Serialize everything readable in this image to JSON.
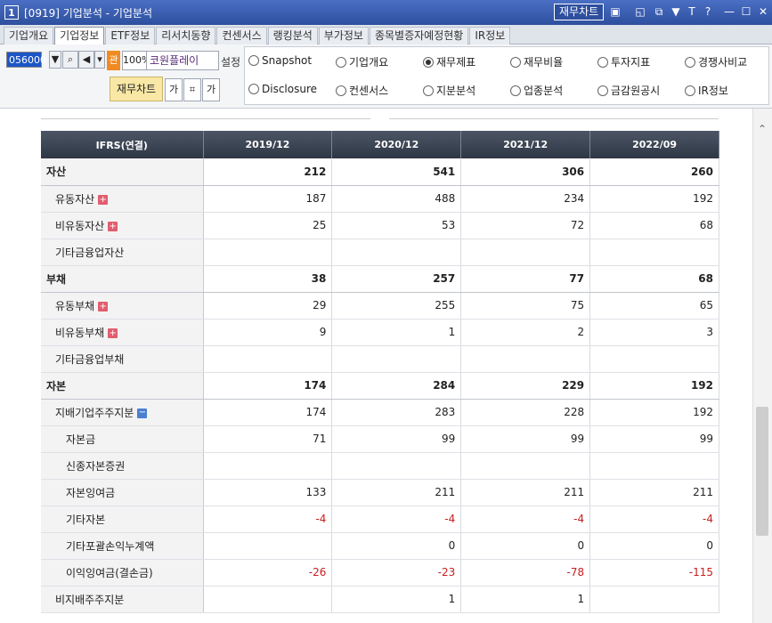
{
  "window": {
    "num": "1",
    "title": "[0919] 기업분석 - 기업분석",
    "chart_button": "재무차트",
    "icons": [
      "chart-icon",
      "restore-icon",
      "copy-icon",
      "pin-icon",
      "font-icon",
      "help-icon",
      "minimize-icon",
      "maximize-icon",
      "close-icon"
    ]
  },
  "tabs": [
    "기업개요",
    "기업정보",
    "ETF정보",
    "리서치동향",
    "컨센서스",
    "랭킹분석",
    "부가정보",
    "종목별증자예정현황",
    "IR정보"
  ],
  "active_tab": 1,
  "toolbar": {
    "code": "056000",
    "pct": "100%",
    "orange": "관",
    "company": "코원플레이",
    "setting": "설정",
    "jaemu_chart": "재무차트",
    "small_a": "가",
    "small_b": "가"
  },
  "radios": [
    {
      "label": "Snapshot",
      "checked": false
    },
    {
      "label": "기업개요",
      "checked": false
    },
    {
      "label": "재무제표",
      "checked": true
    },
    {
      "label": "재무비율",
      "checked": false
    },
    {
      "label": "투자지표",
      "checked": false
    },
    {
      "label": "경쟁사비교",
      "checked": false
    },
    {
      "label": "Disclosure",
      "checked": false
    },
    {
      "label": "컨센서스",
      "checked": false
    },
    {
      "label": "지분분석",
      "checked": false
    },
    {
      "label": "업종분석",
      "checked": false
    },
    {
      "label": "금감원공시",
      "checked": false
    },
    {
      "label": "IR정보",
      "checked": false
    }
  ],
  "table": {
    "headers": [
      "IFRS(연결)",
      "2019/12",
      "2020/12",
      "2021/12",
      "2022/09"
    ],
    "rows": [
      {
        "label": "자산",
        "level": 0,
        "bold": true,
        "values": [
          "212",
          "541",
          "306",
          "260"
        ]
      },
      {
        "label": "유동자산",
        "level": 1,
        "icon": "plus",
        "values": [
          "187",
          "488",
          "234",
          "192"
        ]
      },
      {
        "label": "비유동자산",
        "level": 1,
        "icon": "plus",
        "values": [
          "25",
          "53",
          "72",
          "68"
        ]
      },
      {
        "label": "기타금융업자산",
        "level": 1,
        "values": [
          "",
          "",
          "",
          ""
        ]
      },
      {
        "label": "부채",
        "level": 0,
        "bold": true,
        "values": [
          "38",
          "257",
          "77",
          "68"
        ]
      },
      {
        "label": "유동부채",
        "level": 1,
        "icon": "plus",
        "values": [
          "29",
          "255",
          "75",
          "65"
        ]
      },
      {
        "label": "비유동부채",
        "level": 1,
        "icon": "plus",
        "values": [
          "9",
          "1",
          "2",
          "3"
        ]
      },
      {
        "label": "기타금융업부채",
        "level": 1,
        "values": [
          "",
          "",
          "",
          ""
        ]
      },
      {
        "label": "자본",
        "level": 0,
        "bold": true,
        "values": [
          "174",
          "284",
          "229",
          "192"
        ]
      },
      {
        "label": "지배기업주주지분",
        "level": 1,
        "icon": "minus",
        "values": [
          "174",
          "283",
          "228",
          "192"
        ]
      },
      {
        "label": "자본금",
        "level": 2,
        "values": [
          "71",
          "99",
          "99",
          "99"
        ]
      },
      {
        "label": "신종자본증권",
        "level": 2,
        "values": [
          "",
          "",
          "",
          ""
        ]
      },
      {
        "label": "자본잉여금",
        "level": 2,
        "values": [
          "133",
          "211",
          "211",
          "211"
        ]
      },
      {
        "label": "기타자본",
        "level": 2,
        "values": [
          "-4",
          "-4",
          "-4",
          "-4"
        ]
      },
      {
        "label": "기타포괄손익누계액",
        "level": 2,
        "values": [
          "",
          "0",
          "0",
          "0"
        ]
      },
      {
        "label": "이익잉여금(결손금)",
        "level": 2,
        "values": [
          "-26",
          "-23",
          "-78",
          "-115"
        ]
      },
      {
        "label": "비지배주주지분",
        "level": 1,
        "values": [
          "",
          "1",
          "1",
          ""
        ]
      }
    ]
  }
}
